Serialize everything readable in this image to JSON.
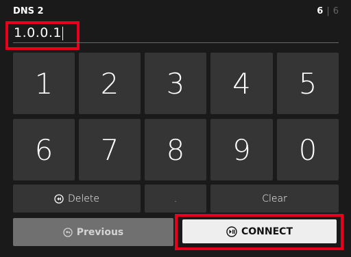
{
  "header": {
    "title": "DNS 2",
    "step_current": "6",
    "step_separator": "|",
    "step_total": "6"
  },
  "entry": {
    "value": "1.0.0.1"
  },
  "keypad": {
    "digits": [
      "1",
      "2",
      "3",
      "4",
      "5",
      "6",
      "7",
      "8",
      "9",
      "0"
    ],
    "delete_label": "Delete",
    "dot_label": ".",
    "clear_label": "Clear"
  },
  "actions": {
    "previous_label": "Previous",
    "connect_label": "CONNECT"
  },
  "colors": {
    "background": "#1a1a1a",
    "key": "#353535",
    "highlight": "#e8001c",
    "connect_bg": "#eeeeee",
    "previous_bg": "#707070"
  },
  "icons": {
    "delete": "rewind-circle-icon",
    "previous": "back-circle-icon",
    "connect": "play-pause-circle-icon"
  }
}
